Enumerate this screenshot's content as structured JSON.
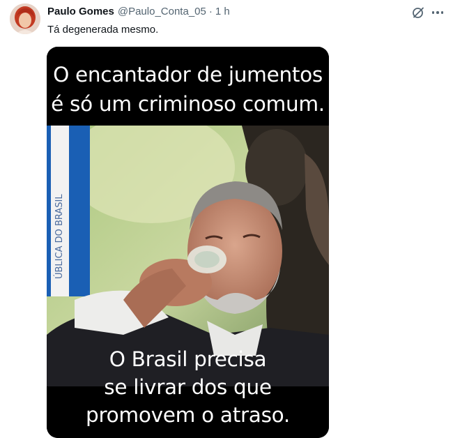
{
  "author": {
    "name": "Paulo Gomes",
    "handle": "@Paulo_Conta_05",
    "separator": "·",
    "time": "1 h"
  },
  "tweet": {
    "text": "Tá degenerada mesmo."
  },
  "media": {
    "caption_top_line1": "O encantador de jumentos",
    "caption_top_line2": "é só um criminoso comum.",
    "caption_bottom_line1": "O Brasil precisa",
    "caption_bottom_line2": "se livrar dos que",
    "caption_bottom_line3": "promovem o atraso.",
    "flag_text": "ÚBLICA DO BRASIL"
  },
  "colors": {
    "text_primary": "#0f1419",
    "text_secondary": "#536471",
    "background": "#ffffff",
    "media_background": "#000000"
  },
  "icons": {
    "grok": "grok-icon",
    "more": "more-options-icon",
    "avatar": "avatar"
  }
}
